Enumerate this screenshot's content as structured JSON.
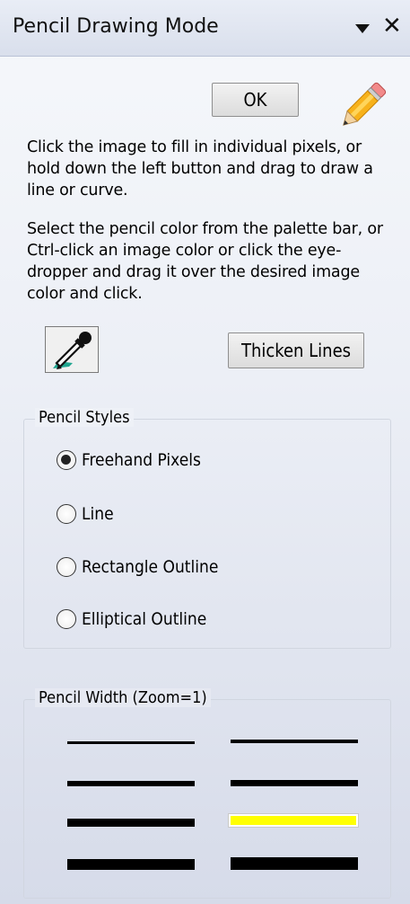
{
  "panel": {
    "title": "Pencil Drawing Mode",
    "ok_label": "OK",
    "instructions_1": "Click the image to fill in individual pixels, or hold down the left button and drag to draw a line or curve.",
    "instructions_2": "Select the pencil color from the palette bar, or Ctrl-click an image color or click the eye-dropper and drag it over the desired image color and click.",
    "thicken_label": "Thicken Lines"
  },
  "styles": {
    "label": "Pencil Styles",
    "options": [
      {
        "label": "Freehand Pixels",
        "checked": true
      },
      {
        "label": "Line",
        "checked": false
      },
      {
        "label": "Rectangle Outline",
        "checked": false
      },
      {
        "label": "Elliptical Outline",
        "checked": false
      }
    ]
  },
  "width": {
    "label": "Pencil Width (Zoom=1)",
    "selected_index": 5,
    "selected_color": "#ffff00"
  },
  "icons": {
    "pencil": "pencil-icon",
    "eyedropper": "eyedropper-icon",
    "dropdown": "dropdown-arrow-icon",
    "close": "close-icon"
  }
}
